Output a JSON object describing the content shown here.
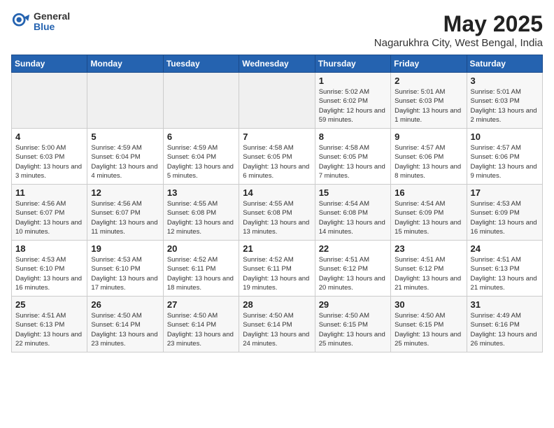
{
  "logo": {
    "general": "General",
    "blue": "Blue"
  },
  "title": "May 2025",
  "subtitle": "Nagarukhra City, West Bengal, India",
  "days_of_week": [
    "Sunday",
    "Monday",
    "Tuesday",
    "Wednesday",
    "Thursday",
    "Friday",
    "Saturday"
  ],
  "weeks": [
    [
      {
        "day": "",
        "info": ""
      },
      {
        "day": "",
        "info": ""
      },
      {
        "day": "",
        "info": ""
      },
      {
        "day": "",
        "info": ""
      },
      {
        "day": "1",
        "info": "Sunrise: 5:02 AM\nSunset: 6:02 PM\nDaylight: 12 hours and 59 minutes."
      },
      {
        "day": "2",
        "info": "Sunrise: 5:01 AM\nSunset: 6:03 PM\nDaylight: 13 hours and 1 minute."
      },
      {
        "day": "3",
        "info": "Sunrise: 5:01 AM\nSunset: 6:03 PM\nDaylight: 13 hours and 2 minutes."
      }
    ],
    [
      {
        "day": "4",
        "info": "Sunrise: 5:00 AM\nSunset: 6:03 PM\nDaylight: 13 hours and 3 minutes."
      },
      {
        "day": "5",
        "info": "Sunrise: 4:59 AM\nSunset: 6:04 PM\nDaylight: 13 hours and 4 minutes."
      },
      {
        "day": "6",
        "info": "Sunrise: 4:59 AM\nSunset: 6:04 PM\nDaylight: 13 hours and 5 minutes."
      },
      {
        "day": "7",
        "info": "Sunrise: 4:58 AM\nSunset: 6:05 PM\nDaylight: 13 hours and 6 minutes."
      },
      {
        "day": "8",
        "info": "Sunrise: 4:58 AM\nSunset: 6:05 PM\nDaylight: 13 hours and 7 minutes."
      },
      {
        "day": "9",
        "info": "Sunrise: 4:57 AM\nSunset: 6:06 PM\nDaylight: 13 hours and 8 minutes."
      },
      {
        "day": "10",
        "info": "Sunrise: 4:57 AM\nSunset: 6:06 PM\nDaylight: 13 hours and 9 minutes."
      }
    ],
    [
      {
        "day": "11",
        "info": "Sunrise: 4:56 AM\nSunset: 6:07 PM\nDaylight: 13 hours and 10 minutes."
      },
      {
        "day": "12",
        "info": "Sunrise: 4:56 AM\nSunset: 6:07 PM\nDaylight: 13 hours and 11 minutes."
      },
      {
        "day": "13",
        "info": "Sunrise: 4:55 AM\nSunset: 6:08 PM\nDaylight: 13 hours and 12 minutes."
      },
      {
        "day": "14",
        "info": "Sunrise: 4:55 AM\nSunset: 6:08 PM\nDaylight: 13 hours and 13 minutes."
      },
      {
        "day": "15",
        "info": "Sunrise: 4:54 AM\nSunset: 6:08 PM\nDaylight: 13 hours and 14 minutes."
      },
      {
        "day": "16",
        "info": "Sunrise: 4:54 AM\nSunset: 6:09 PM\nDaylight: 13 hours and 15 minutes."
      },
      {
        "day": "17",
        "info": "Sunrise: 4:53 AM\nSunset: 6:09 PM\nDaylight: 13 hours and 16 minutes."
      }
    ],
    [
      {
        "day": "18",
        "info": "Sunrise: 4:53 AM\nSunset: 6:10 PM\nDaylight: 13 hours and 16 minutes."
      },
      {
        "day": "19",
        "info": "Sunrise: 4:53 AM\nSunset: 6:10 PM\nDaylight: 13 hours and 17 minutes."
      },
      {
        "day": "20",
        "info": "Sunrise: 4:52 AM\nSunset: 6:11 PM\nDaylight: 13 hours and 18 minutes."
      },
      {
        "day": "21",
        "info": "Sunrise: 4:52 AM\nSunset: 6:11 PM\nDaylight: 13 hours and 19 minutes."
      },
      {
        "day": "22",
        "info": "Sunrise: 4:51 AM\nSunset: 6:12 PM\nDaylight: 13 hours and 20 minutes."
      },
      {
        "day": "23",
        "info": "Sunrise: 4:51 AM\nSunset: 6:12 PM\nDaylight: 13 hours and 21 minutes."
      },
      {
        "day": "24",
        "info": "Sunrise: 4:51 AM\nSunset: 6:13 PM\nDaylight: 13 hours and 21 minutes."
      }
    ],
    [
      {
        "day": "25",
        "info": "Sunrise: 4:51 AM\nSunset: 6:13 PM\nDaylight: 13 hours and 22 minutes."
      },
      {
        "day": "26",
        "info": "Sunrise: 4:50 AM\nSunset: 6:14 PM\nDaylight: 13 hours and 23 minutes."
      },
      {
        "day": "27",
        "info": "Sunrise: 4:50 AM\nSunset: 6:14 PM\nDaylight: 13 hours and 23 minutes."
      },
      {
        "day": "28",
        "info": "Sunrise: 4:50 AM\nSunset: 6:14 PM\nDaylight: 13 hours and 24 minutes."
      },
      {
        "day": "29",
        "info": "Sunrise: 4:50 AM\nSunset: 6:15 PM\nDaylight: 13 hours and 25 minutes."
      },
      {
        "day": "30",
        "info": "Sunrise: 4:50 AM\nSunset: 6:15 PM\nDaylight: 13 hours and 25 minutes."
      },
      {
        "day": "31",
        "info": "Sunrise: 4:49 AM\nSunset: 6:16 PM\nDaylight: 13 hours and 26 minutes."
      }
    ]
  ]
}
